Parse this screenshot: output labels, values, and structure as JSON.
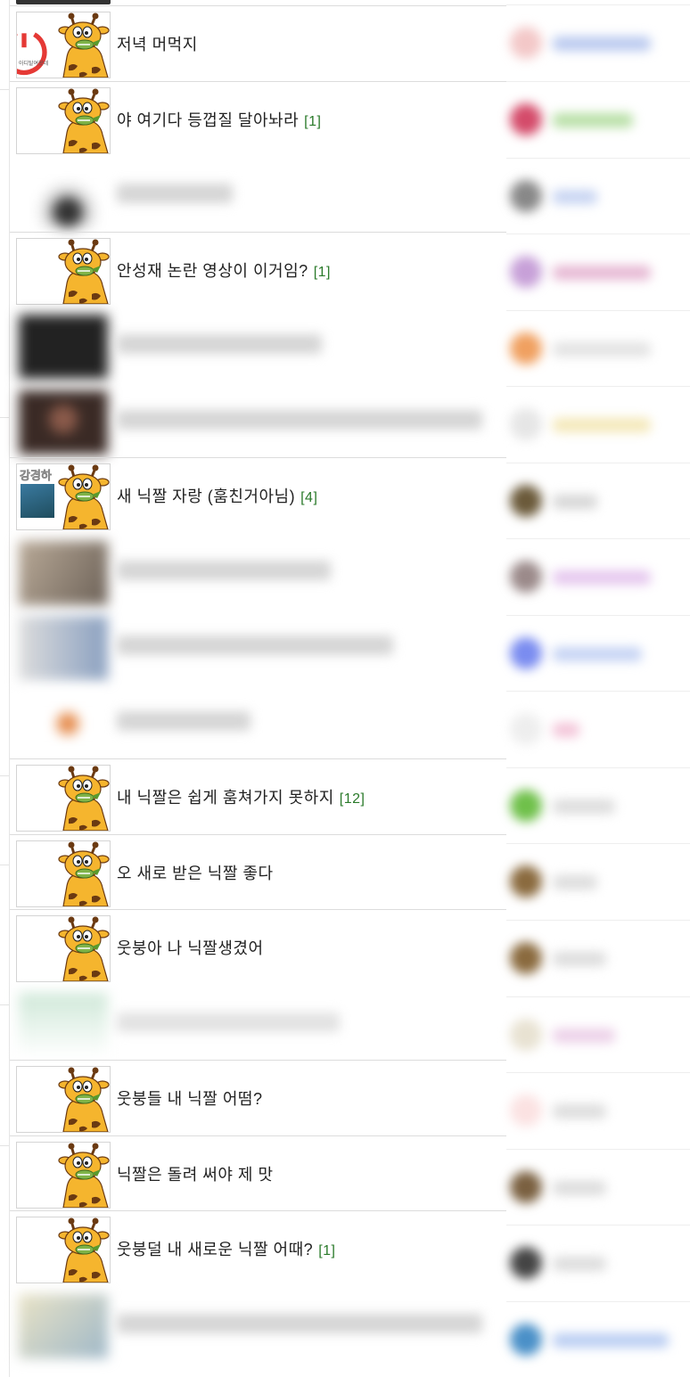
{
  "posts": [
    {
      "title": "저녁 머먹지",
      "count": "",
      "thumb_caption": "아디탈여왔네"
    },
    {
      "title": "야 여기다 등껍질 달아놔라",
      "count": "[1]"
    },
    {
      "title": "안성재 논란 영상이 이거임?",
      "count": "[1]"
    },
    {
      "title": "새 닉짤 자랑 (훔친거아님)",
      "count": "[4]",
      "thumb_caption": "강경하"
    },
    {
      "title": "내 닉짤은 쉽게 훔쳐가지 못하지",
      "count": "[12]"
    },
    {
      "title": "오 새로 받은 닉짤 좋다",
      "count": ""
    },
    {
      "title": "웃붕아 나 닉짤생겼어",
      "count": ""
    },
    {
      "title": "웃붕들 내 닉짤 어떰?",
      "count": ""
    },
    {
      "title": "닉짤은 돌려 써야 제 맛",
      "count": ""
    },
    {
      "title": "웃붕덜 내 새로운 닉짤 어때?",
      "count": "[1]"
    }
  ],
  "colors": {
    "comment_count": "#2a7a2a",
    "divider": "#dcdcdc",
    "giraffe_body": "#f5b52e",
    "giraffe_spots": "#6b3a12"
  },
  "icons": {
    "post_thumb": "giraffe-mascot-icon"
  }
}
